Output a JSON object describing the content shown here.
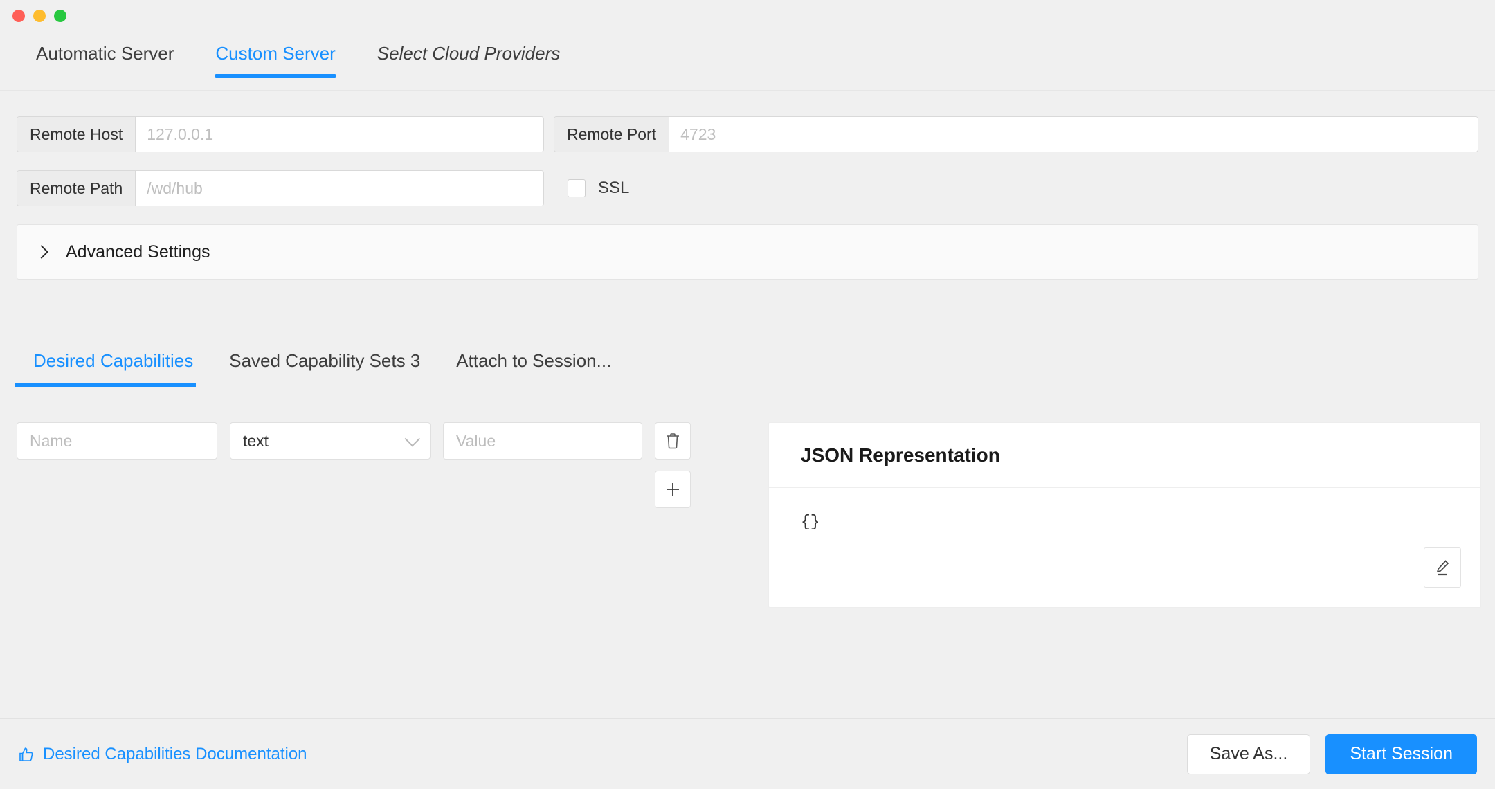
{
  "window": {
    "traffic_lights": [
      "close",
      "minimize",
      "maximize"
    ]
  },
  "server_tabs": [
    {
      "label": "Automatic Server",
      "active": false,
      "italic": false
    },
    {
      "label": "Custom Server",
      "active": true,
      "italic": false
    },
    {
      "label": "Select Cloud Providers",
      "active": false,
      "italic": true
    }
  ],
  "form": {
    "remote_host": {
      "label": "Remote Host",
      "value": "",
      "placeholder": "127.0.0.1"
    },
    "remote_port": {
      "label": "Remote Port",
      "value": "",
      "placeholder": "4723"
    },
    "remote_path": {
      "label": "Remote Path",
      "value": "",
      "placeholder": "/wd/hub"
    },
    "ssl": {
      "label": "SSL",
      "checked": false
    },
    "advanced_settings": {
      "label": "Advanced Settings",
      "expanded": false
    }
  },
  "capability_tabs": [
    {
      "label": "Desired Capabilities",
      "active": true
    },
    {
      "label": "Saved Capability Sets 3",
      "active": false
    },
    {
      "label": "Attach to Session...",
      "active": false
    }
  ],
  "capability_row": {
    "name": {
      "value": "",
      "placeholder": "Name"
    },
    "type": {
      "selected": "text"
    },
    "value": {
      "value": "",
      "placeholder": "Value"
    },
    "delete_title": "Delete",
    "add_title": "Add"
  },
  "json_panel": {
    "title": "JSON Representation",
    "content": "{}",
    "edit_title": "Edit"
  },
  "footer": {
    "doc_link": "Desired Capabilities Documentation",
    "save_as": "Save As...",
    "start_session": "Start Session"
  },
  "colors": {
    "accent": "#1890ff",
    "background": "#f0f0f0",
    "panel": "#ffffff",
    "traffic_close": "#ff5f57",
    "traffic_min": "#febc2e",
    "traffic_max": "#28c840"
  }
}
